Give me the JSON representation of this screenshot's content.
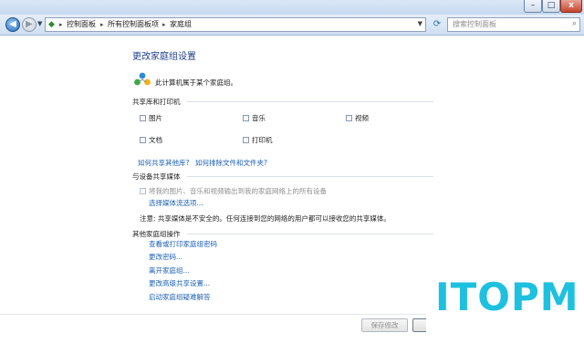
{
  "window": {
    "minimize_glyph": "–",
    "maximize_glyph": "□",
    "close_glyph": "x"
  },
  "nav": {
    "back_glyph": "◀",
    "forward_glyph": "▶",
    "breadcrumbs": [
      "控制面板",
      "所有控制面板项",
      "家庭组"
    ],
    "separator": "▸",
    "refresh_glyph": "⟳",
    "search_placeholder": "搜索控制面板"
  },
  "page": {
    "title": "更改家庭组设置",
    "status": "此计算机属于某个家庭组。"
  },
  "libraries": {
    "heading": "共享库和打印机",
    "items": [
      {
        "label": "图片",
        "checked": false
      },
      {
        "label": "音乐",
        "checked": false
      },
      {
        "label": "视频",
        "checked": false
      },
      {
        "label": "文档",
        "checked": false
      },
      {
        "label": "打印机",
        "checked": false
      }
    ],
    "link_share_other": "如何共享其他库?",
    "link_exclude": "如何排除文件和文件夹?"
  },
  "media": {
    "heading": "与设备共享媒体",
    "stream_label": "将我的图片、音乐和视频输出到我的家庭网络上的所有设备",
    "stream_checked": false,
    "choose_link": "选择媒体流选项...",
    "note": "注意: 共享媒体是不安全的。任何连接到您的网络的用户都可以接收您的共享媒体。"
  },
  "other": {
    "heading": "其他家庭组操作",
    "links": [
      "查看或打印家庭组密码",
      "更改密码...",
      "离开家庭组...",
      "更改高级共享设置...",
      "启动家庭组疑难解答"
    ]
  },
  "footer": {
    "save_label": "保存修改",
    "cancel_label": "取消"
  },
  "watermark": {
    "text": "ITOPM",
    "color": "#1ec0e0"
  }
}
